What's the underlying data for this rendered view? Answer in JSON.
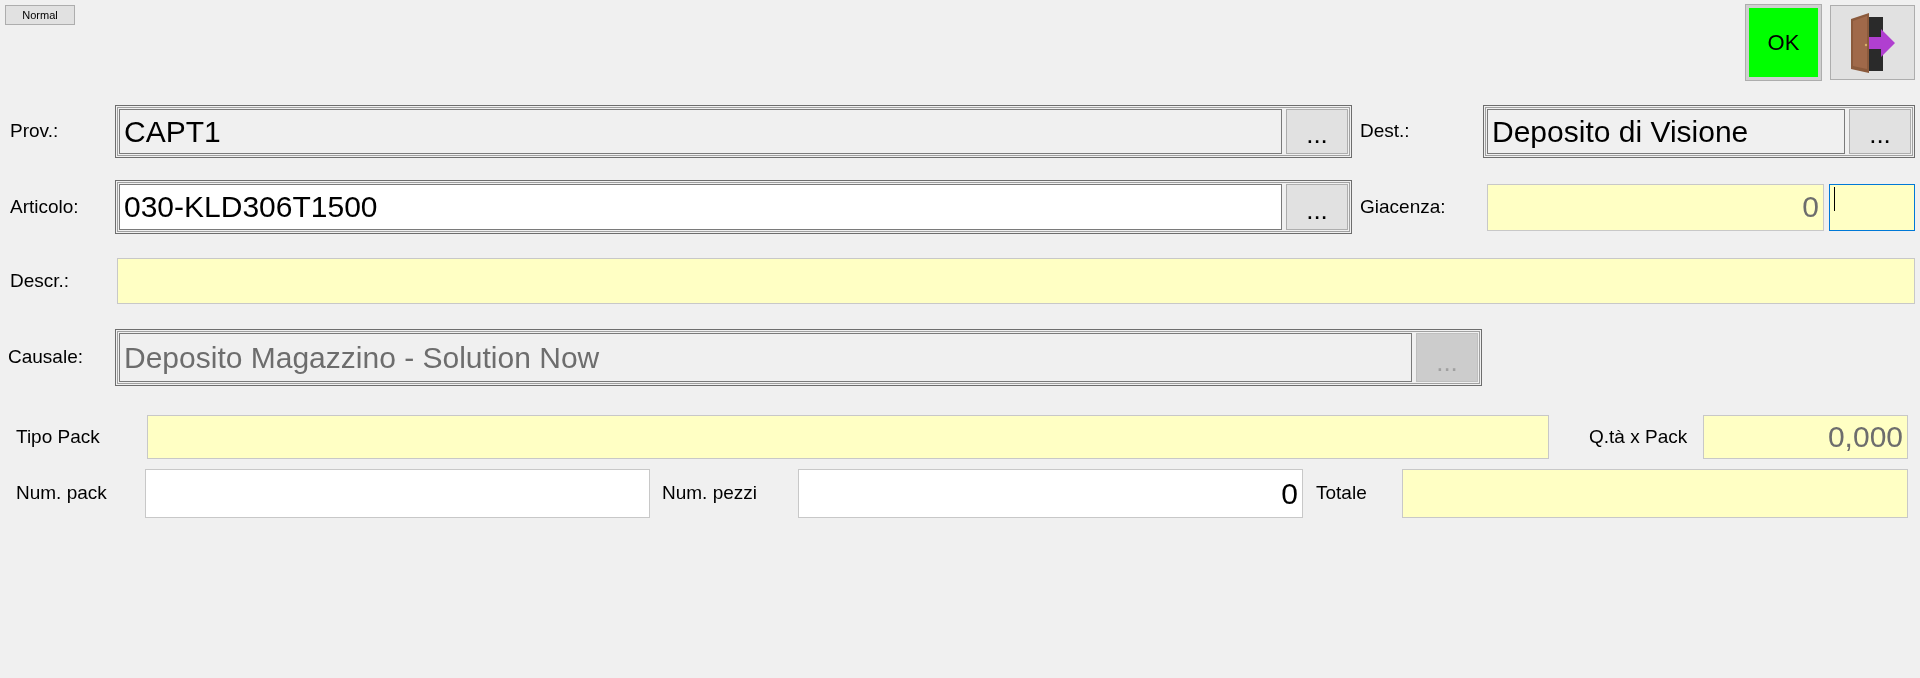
{
  "toolbar": {
    "mode_button": "Normal",
    "ok_button": "OK"
  },
  "prov": {
    "label": "Prov.:",
    "value": "CAPT1",
    "button": "...",
    "readonly": true,
    "disabled": false
  },
  "dest": {
    "label": "Dest.:",
    "value": "Deposito di Visione",
    "button": "...",
    "readonly": true,
    "disabled": false
  },
  "articolo": {
    "label": "Articolo:",
    "value": "030-KLD306T1500",
    "button": "...",
    "readonly": false,
    "disabled": false
  },
  "giacenza": {
    "label": "Giacenza:",
    "value": "0",
    "readonly": true,
    "extra_field": {
      "focused": true
    }
  },
  "descr": {
    "label": "Descr.:",
    "readonly": true
  },
  "causale": {
    "label": "Causale:",
    "value": "Deposito Magazzino - Solution Now",
    "button": "...",
    "disabled": true
  },
  "tipo_pack": {
    "label": "Tipo Pack",
    "readonly": true
  },
  "qta_pack": {
    "label": "Q.tà x Pack",
    "value": "0,000",
    "readonly": true
  },
  "num_pack": {
    "label": "Num. pack",
    "readonly": false
  },
  "num_pezzi": {
    "label": "Num. pezzi",
    "value": "0",
    "readonly": false
  },
  "totale": {
    "label": "Totale",
    "readonly": true
  }
}
